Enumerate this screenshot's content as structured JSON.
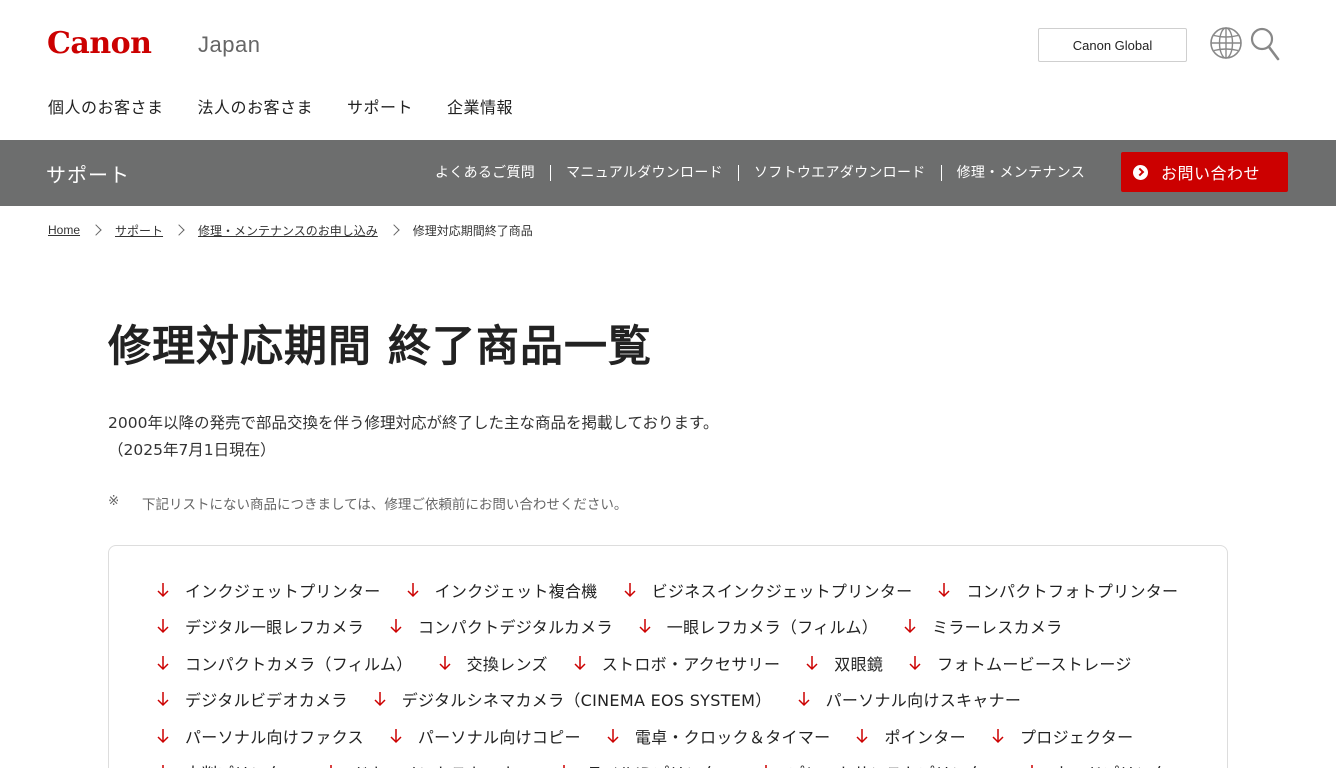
{
  "header": {
    "logo": "Canon",
    "region": "Japan",
    "global_button": "Canon Global",
    "nav": [
      "個人のお客さま",
      "法人のお客さま",
      "サポート",
      "企業情報"
    ]
  },
  "support_bar": {
    "title": "サポート",
    "links": [
      "よくあるご質問",
      "マニュアルダウンロード",
      "ソフトウエアダウンロード",
      "修理・メンテナンス"
    ],
    "contact_button": "お問い合わせ"
  },
  "breadcrumb": {
    "items": [
      "Home",
      "サポート",
      "修理・メンテナンスのお申し込み"
    ],
    "current": "修理対応期間終了商品"
  },
  "page": {
    "title": "修理対応期間 終了商品一覧",
    "intro_line1": "2000年以降の発売で部品交換を伴う修理対応が終了した主な商品を掲載しております。",
    "intro_line2": "（2025年7月1日現在）",
    "note_mark": "※",
    "note_text": "下記リストにない商品につきましては、修理ご依頼前にお問い合わせください。"
  },
  "categories": {
    "row1": [
      "インクジェットプリンター",
      "インクジェット複合機",
      "ビジネスインクジェットプリンター",
      "コンパクトフォトプリンター"
    ],
    "row2": [
      "デジタル一眼レフカメラ",
      "コンパクトデジタルカメラ",
      "一眼レフカメラ（フィルム）",
      "ミラーレスカメラ"
    ],
    "row3": [
      "コンパクトカメラ（フィルム）",
      "交換レンズ",
      "ストロボ・アクセサリー",
      "双眼鏡",
      "フォトムービーストレージ"
    ],
    "row4": [
      "デジタルビデオカメラ",
      "デジタルシネマカメラ（CINEMA EOS SYSTEM）",
      "パーソナル向けスキャナー"
    ],
    "row5": [
      "パーソナル向けファクス",
      "パーソナル向けコピー",
      "電卓・クロック＆タイマー",
      "ポインター",
      "プロジェクター"
    ],
    "row6": [
      "大判プリンター",
      "ドキュメントスキャナー",
      "ラベルIDプリンター",
      "プレートサンストプリンター",
      "カードプリンター"
    ]
  },
  "colors": {
    "brand_red": "#cc0000",
    "support_bar_bg": "#6d6e6e",
    "arrow_red": "#cc0000"
  }
}
